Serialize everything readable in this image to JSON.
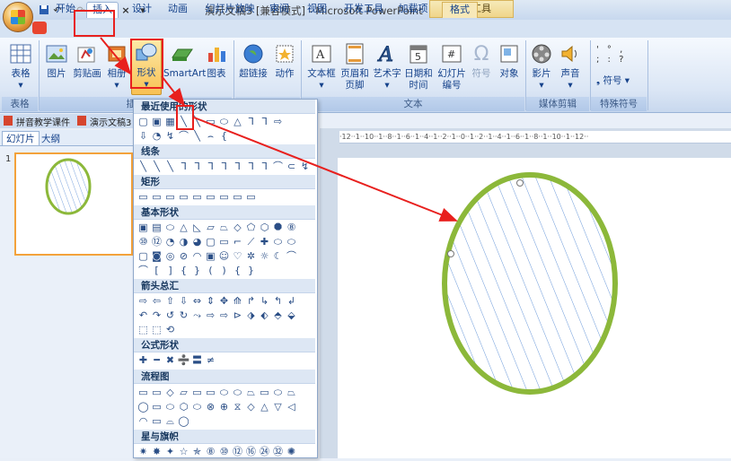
{
  "window": {
    "title": "演示文稿3 [兼容模式] - Microsoft PowerPoint",
    "context_tab": "绘图工具",
    "qat_undo": "↶",
    "qat_redo": "↷",
    "qat_more": "×"
  },
  "tabs": [
    "开始",
    "插入",
    "设计",
    "动画",
    "幻灯片放映",
    "审阅",
    "视图",
    "开发工具",
    "加载项",
    "格式"
  ],
  "ribbon": {
    "groups": {
      "table": "表格",
      "illustrations": "插图",
      "text": "文本",
      "media": "媒体剪辑",
      "symbols": "特殊符号"
    },
    "buttons": {
      "table": "表格",
      "picture": "图片",
      "clipart": "剪贴画",
      "album": "相册",
      "shapes": "形状",
      "smartart": "SmartArt",
      "chart": "图表",
      "hyperlink": "超链接",
      "action": "动作",
      "textbox": "文本框",
      "header_footer": "页眉和页脚",
      "wordart": "艺术字",
      "datetime": "日期和时间",
      "slide_number": "幻灯片编号",
      "symbol": "符号",
      "object": "对象",
      "movie": "影片",
      "sound": "声音",
      "special_symbol": "符号"
    }
  },
  "doc_tabs": [
    "拼音教学课件",
    "演示文稿3"
  ],
  "left_pane_tabs": [
    "幻灯片",
    "大纲"
  ],
  "slide_number": "1",
  "shapes_menu": {
    "categories": [
      "最近使用的形状",
      "线条",
      "矩形",
      "基本形状",
      "箭头总汇",
      "公式形状",
      "流程图",
      "星与旗帜"
    ],
    "recent_row1": [
      "▢",
      "▣",
      "▦",
      "╲",
      "╲",
      "▭",
      "⬭",
      "△",
      "ᒣ",
      "ᒣ",
      "⇨"
    ],
    "recent_row2": [
      "⇩",
      "◔",
      "↯",
      "⌒",
      "╲",
      "⌢",
      "{"
    ],
    "lines_row": [
      "╲",
      "╲",
      "╲",
      "ᒣ",
      "ᒣ",
      "ᒣ",
      "ᒣ",
      "ᒣ",
      "ᒣ",
      "ᒣ",
      "⌒",
      "⊂",
      "↯"
    ],
    "rect_row": [
      "▭",
      "▭",
      "▭",
      "▭",
      "▭",
      "▭",
      "▭",
      "▭",
      "▭"
    ],
    "basic_row1": [
      "▣",
      "▤",
      "⬭",
      "△",
      "◺",
      "▱",
      "⏢",
      "◇",
      "⬠",
      "⬡",
      "⯃",
      "⑧"
    ],
    "basic_row2": [
      "⑩",
      "⑫",
      "◔",
      "◑",
      "◕",
      "▢",
      "▭",
      "⌐",
      "⟋",
      "✚",
      "⬭",
      "⬭"
    ],
    "basic_row3": [
      "▢",
      "◙",
      "◎",
      "⊘",
      "◠",
      "▣",
      "☺",
      "♡",
      "✲",
      "☼",
      "☾",
      "⌒"
    ],
    "basic_row4": [
      "⌒",
      "[",
      "]",
      "{",
      "}",
      "(",
      ")",
      "{",
      "}"
    ],
    "arrows_row1": [
      "⇨",
      "⇦",
      "⇧",
      "⇩",
      "⇔",
      "⇕",
      "✥",
      "⟰",
      "↱",
      "↳",
      "↰",
      "↲"
    ],
    "arrows_row2": [
      "↶",
      "↷",
      "↺",
      "↻",
      "⤳",
      "⇨",
      "⇨",
      "⊳",
      "⬗",
      "⬖",
      "⬘",
      "⬙"
    ],
    "arrows_row3": [
      "⬚",
      "⬚",
      "⟲"
    ],
    "formula_row": [
      "✚",
      "━",
      "✖",
      "➗",
      "〓",
      "≠"
    ],
    "flow_row1": [
      "▭",
      "▭",
      "◇",
      "▱",
      "▭",
      "▭",
      "⬭",
      "⬭",
      "⏢",
      "▭",
      "⬭",
      "⏢"
    ],
    "flow_row2": [
      "◯",
      "▭",
      "⬭",
      "⬡",
      "⬭",
      "⊗",
      "⊕",
      "⧖",
      "◇",
      "△",
      "▽",
      "◁"
    ],
    "flow_row3": [
      "◠",
      "▭",
      "⌓",
      "◯"
    ],
    "stars_row": [
      "✷",
      "✸",
      "✦",
      "☆",
      "✯",
      "⑧",
      "⑩",
      "⑫",
      "⑯",
      "㉔",
      "㉜",
      "✺"
    ]
  },
  "ruler_text": "·12··1··10··1··8··1··6··1··4··1··2··1··0··1··2··1··4··1··6··1··8··1··10··1··12··",
  "colors": {
    "accent_red": "#e8201e",
    "ellipse_green": "#8cb83a",
    "hatch_blue": "#5b8ed6",
    "tab_active_border": "#99b3d6"
  }
}
